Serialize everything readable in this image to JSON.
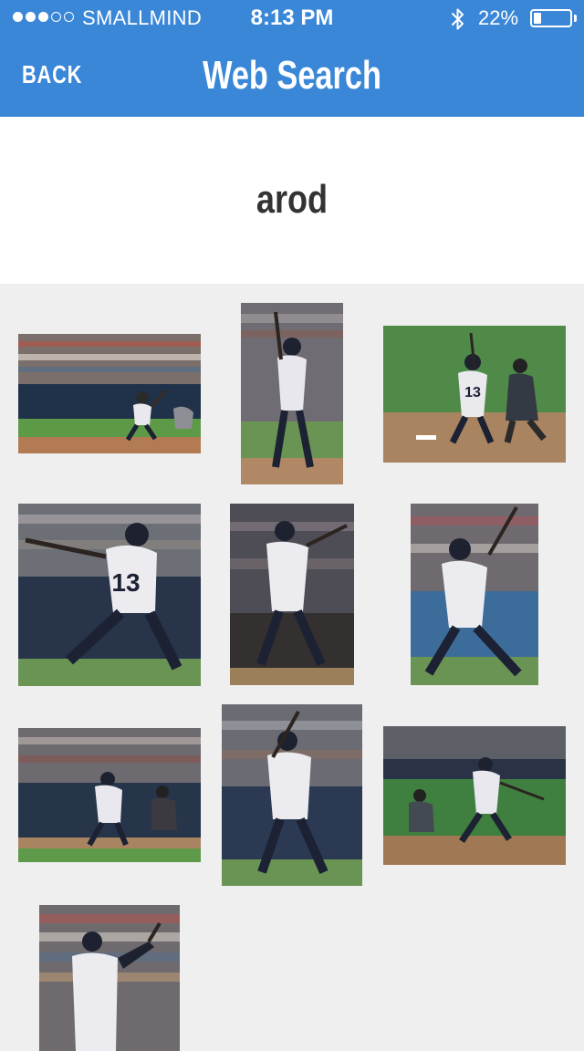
{
  "status_bar": {
    "carrier": "SMALLMIND",
    "time": "8:13 PM",
    "battery_percent": "22%",
    "battery_level": 0.22,
    "signal_bars": 3,
    "signal_max": 5,
    "icons": [
      "signal-dots-icon",
      "bluetooth-icon",
      "battery-icon"
    ]
  },
  "nav": {
    "back_label": "BACK",
    "title": "Web Search"
  },
  "search": {
    "query": "arod"
  },
  "results": [
    {
      "id": "result-1",
      "jersey": ""
    },
    {
      "id": "result-2",
      "jersey": ""
    },
    {
      "id": "result-3",
      "jersey": "13"
    },
    {
      "id": "result-4",
      "jersey": "13"
    },
    {
      "id": "result-5",
      "jersey": ""
    },
    {
      "id": "result-6",
      "jersey": ""
    },
    {
      "id": "result-7",
      "jersey": ""
    },
    {
      "id": "result-8",
      "jersey": ""
    },
    {
      "id": "result-9",
      "jersey": ""
    },
    {
      "id": "result-10",
      "jersey": ""
    }
  ],
  "colors": {
    "nav_bar": "#3a87d8",
    "nav_text": "#ffffff",
    "query_background": "#ffffff",
    "query_text": "#333333",
    "grid_background": "#efefef"
  }
}
